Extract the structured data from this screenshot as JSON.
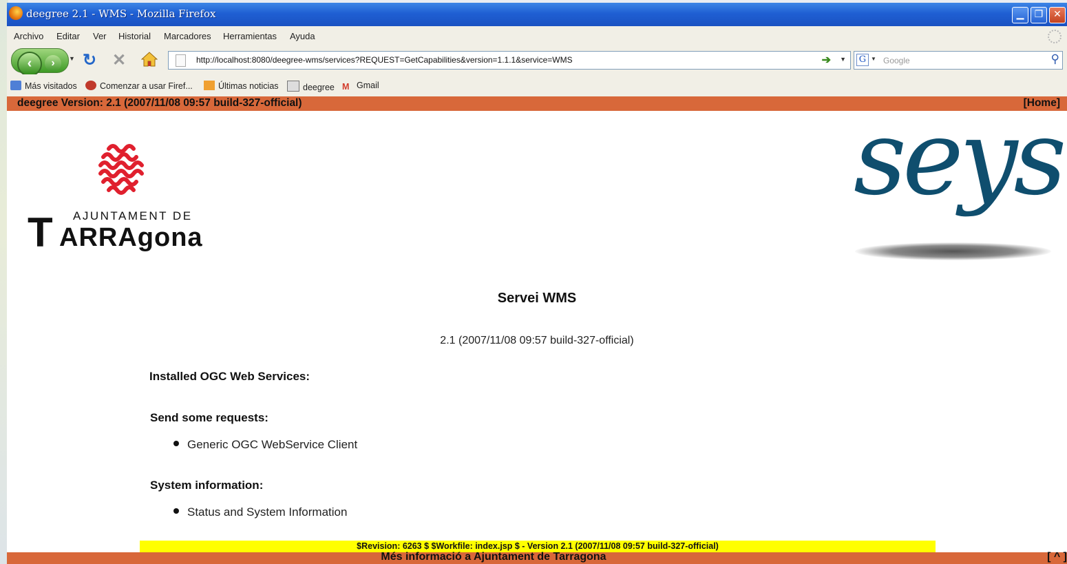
{
  "window": {
    "title": "deegree 2.1 - WMS - Mozilla Firefox"
  },
  "menu": [
    "Archivo",
    "Editar",
    "Ver",
    "Historial",
    "Marcadores",
    "Herramientas",
    "Ayuda"
  ],
  "nav": {
    "url": "http://localhost:8080/deegree-wms/services?REQUEST=GetCapabilities&version=1.1.1&service=WMS",
    "search_placeholder": "Google"
  },
  "bookmarks": [
    "Más visitados",
    "Comenzar a usar Firef...",
    "Últimas noticias",
    "deegree",
    "Gmail"
  ],
  "page": {
    "version_bar": "deegree Version: 2.1 (2007/11/08 09:57 build-327-official)",
    "home_link": "[Home]",
    "logo_left_line1": "AJUNTAMENT DE",
    "logo_left_t": "T",
    "logo_left_rest": "ARRAgona",
    "logo_right": "seys",
    "title": "Servei WMS",
    "subtitle": "2.1 (2007/11/08 09:57 build-327-official)",
    "installed_heading": "Installed OGC Web Services:",
    "send_heading": "Send some requests:",
    "send_items": [
      "Generic OGC WebService Client"
    ],
    "system_heading": "System information:",
    "system_items": [
      "Status and System Information"
    ],
    "revision": "$Revision: 6263 $ $Workfile: index.jsp $ - Version 2.1 (2007/11/08 09:57 build-327-official)",
    "footer": "Més informació a Ajuntament de Tarragona",
    "top_link": "[ ^ ]"
  },
  "colors": {
    "accent_bar": "#d8683a",
    "revision_bg": "#ffff00",
    "seys_blue": "#0f4e6e",
    "titlebar": "#1f5fd3"
  }
}
